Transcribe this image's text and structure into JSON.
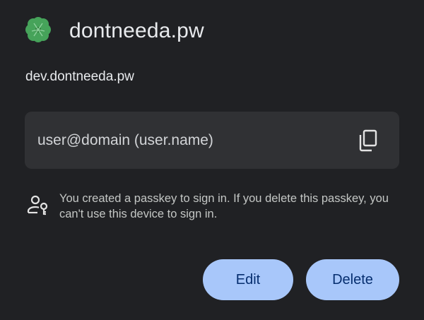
{
  "header": {
    "icon": "clover-icon",
    "title": "dontneeda.pw"
  },
  "domain": "dev.dontneeda.pw",
  "account": {
    "value": "user@domain (user.name)",
    "copy_icon": "copy-icon"
  },
  "info": {
    "icon": "person-key-icon",
    "text": "You created a passkey to sign in. If you delete this passkey, you can't use this device to sign in."
  },
  "buttons": {
    "edit": "Edit",
    "delete": "Delete"
  },
  "colors": {
    "background": "#202124",
    "field": "#303134",
    "button": "#a8c7fa",
    "button_text": "#062e6f",
    "clover": "#4caf50"
  }
}
